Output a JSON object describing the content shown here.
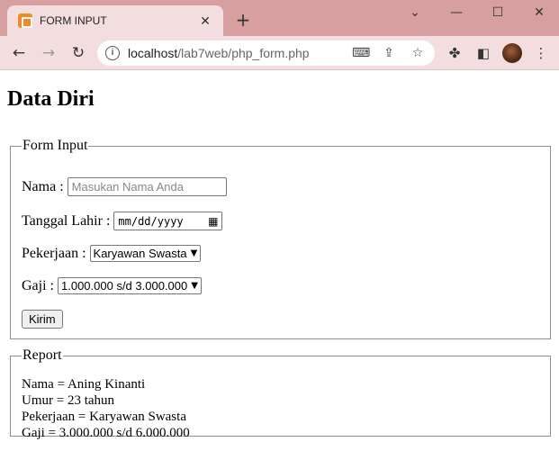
{
  "browser": {
    "tab_title": "FORM INPUT",
    "tab_close": "✕",
    "new_tab": "+",
    "url_host": "localhost",
    "url_path": "/lab7web/php_form.php",
    "controls": {
      "minimize": "—",
      "maximize": "☐",
      "close": "✕",
      "tab_list": "⌄"
    }
  },
  "page": {
    "title": "Data Diri",
    "form": {
      "legend": "Form Input",
      "nama_label": "Nama :",
      "nama_placeholder": "Masukan Nama Anda",
      "tanggal_label": "Tanggal Lahir :",
      "tanggal_value": "mm/dd/yyyy",
      "pekerjaan_label": "Pekerjaan :",
      "pekerjaan_selected": "Karyawan Swasta",
      "gaji_label": "Gaji :",
      "gaji_selected": "1.000.000 s/d 3.000.000",
      "submit_label": "Kirim"
    },
    "report": {
      "legend": "Report",
      "lines": [
        "Nama = Aning Kinanti",
        "Umur = 23 tahun",
        "Pekerjaan = Karyawan Swasta",
        "Gaji = 3.000.000 s/d 6.000.000"
      ]
    }
  },
  "icons": {
    "back": "back-arrow-icon",
    "forward": "forward-arrow-icon",
    "reload": "reload-icon",
    "info": "site-info-icon",
    "translate": "translate-icon",
    "share": "share-icon",
    "bookmark": "bookmark-star-icon",
    "extensions": "puzzle-icon",
    "sidepanel": "side-panel-icon",
    "menu": "kebab-menu-icon",
    "calendar": "calendar-icon"
  }
}
